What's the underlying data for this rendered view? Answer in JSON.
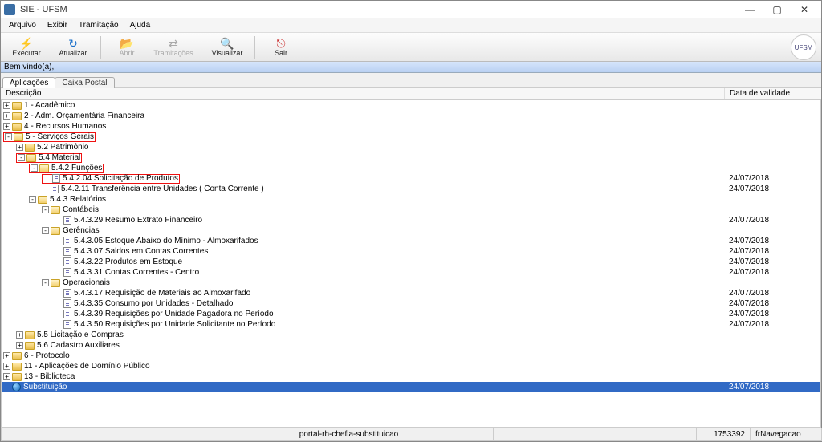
{
  "window": {
    "title": "SIE - UFSM",
    "controls": {
      "min": "—",
      "max": "▢",
      "close": "✕"
    }
  },
  "menu": [
    "Arquivo",
    "Exibir",
    "Tramitação",
    "Ajuda"
  ],
  "toolbar": {
    "executar": "Executar",
    "atualizar": "Atualizar",
    "abrir": "Abrir",
    "tramitacoes": "Tramitações",
    "visualizar": "Visualizar",
    "sair": "Sair"
  },
  "welcome": "Bem vindo(a),",
  "tabs": {
    "aplicacoes": "Aplicações",
    "caixa_postal": "Caixa Postal"
  },
  "columns": {
    "descricao": "Descrição",
    "data_validade": "Data de validade"
  },
  "tree": {
    "n1": "1 - Acadêmico",
    "n2": "2 - Adm. Orçamentária Financeira",
    "n4": "4 - Recursos Humanos",
    "n5": "5 - Serviços Gerais",
    "n52": "5.2 Patrimônio",
    "n54": "5.4 Material",
    "n542": "5.4.2 Funções",
    "n54204": "5.4.2.04 Solicitação de Produtos",
    "n54211": "5.4.2.11 Transferência entre Unidades ( Conta Corrente )",
    "n543": "5.4.3 Relatórios",
    "contabeis": "Contábeis",
    "n54329": "5.4.3.29 Resumo Extrato Financeiro",
    "gerenciais": "Gerências",
    "n54305": "5.4.3.05 Estoque Abaixo do Mínimo - Almoxarifados",
    "n54307": "5.4.3.07 Saldos em Contas Correntes",
    "n54322": "5.4.3.22 Produtos em Estoque",
    "n54331": "5.4.3.31 Contas Correntes - Centro",
    "operacionais": "Operacionais",
    "n54317": "5.4.3.17 Requisição de Materiais ao Almoxarifado",
    "n54335": "5.4.3.35 Consumo por Unidades - Detalhado",
    "n54339": "5.4.3.39 Requisições por Unidade Pagadora no Período",
    "n54350": "5.4.3.50 Requisições por Unidade Solicitante no Período",
    "n55": "5.5 Licitação e Compras",
    "n56": "5.6 Cadastro Auxiliares",
    "n6": "6 - Protocolo",
    "n11": "11 - Aplicações de Domínio Público",
    "n13": "13 - Biblioteca",
    "substituicao": "Substituição"
  },
  "dates": {
    "n54204": "24/07/2018",
    "n54211": "24/07/2018",
    "n54329": "24/07/2018",
    "n54305": "24/07/2018",
    "n54307": "24/07/2018",
    "n54322": "24/07/2018",
    "n54331": "24/07/2018",
    "n54317": "24/07/2018",
    "n54335": "24/07/2018",
    "n54339": "24/07/2018",
    "n54350": "24/07/2018",
    "substituicao": "24/07/2018"
  },
  "status": {
    "center": "portal-rh-chefia-substituicao",
    "code": "1753392",
    "form": "frNavegacao"
  }
}
